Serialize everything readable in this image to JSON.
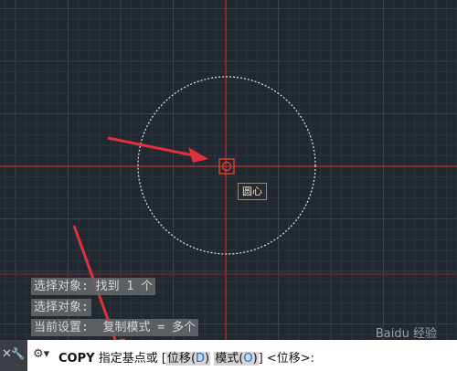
{
  "history": [
    "选择对象: 找到 1 个",
    "选择对象:",
    "当前设置:  复制模式 = 多个"
  ],
  "tooltip": "圆心",
  "command": {
    "name": "COPY",
    "prompt": "指定基点或",
    "bracket_open": "[",
    "options": [
      {
        "label": "位移",
        "key": "D"
      },
      {
        "label": "模式",
        "key": "O"
      }
    ],
    "bracket_close": "]",
    "default": "<位移>:"
  },
  "cmd_icons": {
    "close": "close-icon",
    "customize": "wrench-icon",
    "command": "command-icon"
  },
  "watermark": "Baidu 经验",
  "colors": {
    "background": "#212830",
    "grid_minor": "#2b333d",
    "grid_major": "#38414c",
    "crosshair": "#e03030",
    "circle": "#e8e8e8",
    "arrow": "#e0303a"
  }
}
